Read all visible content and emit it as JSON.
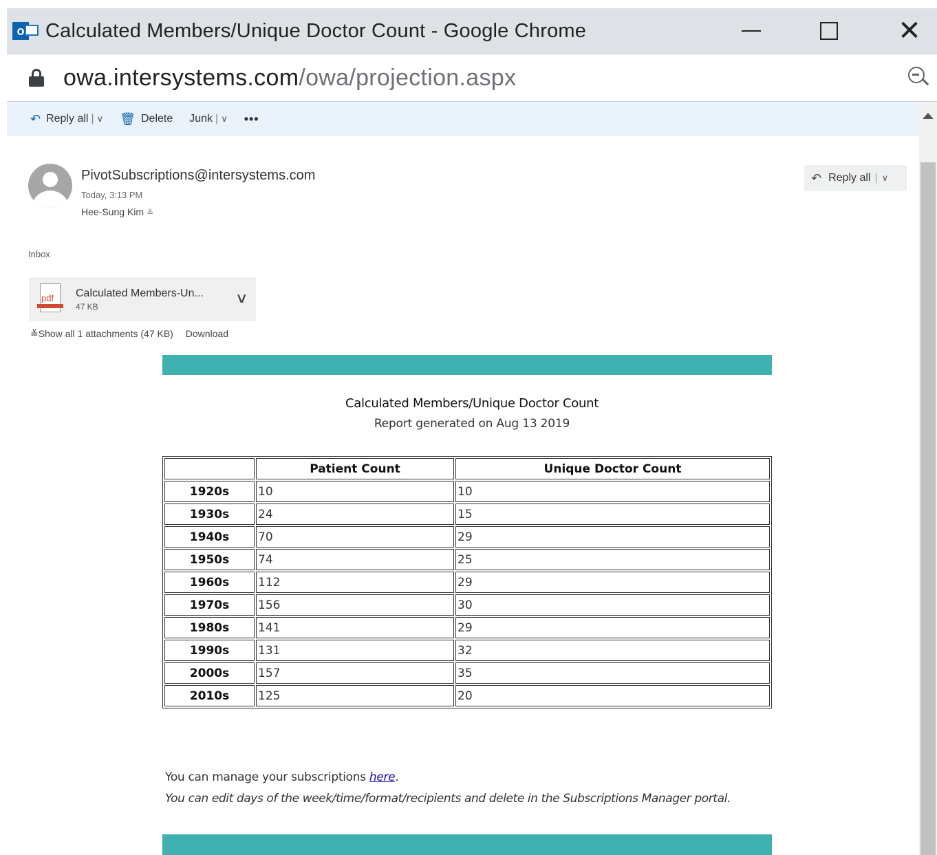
{
  "window": {
    "title": "Calculated Members/Unique Doctor Count - Google Chrome",
    "minimize_symbol": "",
    "maximize_symbol": "",
    "close_symbol": "✕"
  },
  "address": {
    "host": "owa.intersystems.com",
    "path": "/owa/projection.aspx"
  },
  "toolbar": {
    "reply_all": "Reply all",
    "delete": "Delete",
    "junk": "Junk",
    "more": "•••"
  },
  "email": {
    "sender": "PivotSubscriptions@intersystems.com",
    "time": "Today, 3:13 PM",
    "recipient": "Hee-Sung Kim",
    "folder": "Inbox",
    "reply_all": "Reply all",
    "attachment": {
      "name": "Calculated Members-Un...",
      "size": "47 KB",
      "icon_label": "pdf"
    },
    "show_all": "Show all 1 attachments (47 KB)",
    "download": "Download"
  },
  "report": {
    "title": "Calculated Members/Unique Doctor Count",
    "subtitle": "Report generated on Aug 13 2019",
    "columns": [
      "",
      "Patient Count",
      "Unique Doctor Count"
    ],
    "rows": [
      {
        "label": "1920s",
        "patient": "10",
        "doctor": "10"
      },
      {
        "label": "1930s",
        "patient": "24",
        "doctor": "15"
      },
      {
        "label": "1940s",
        "patient": "70",
        "doctor": "29"
      },
      {
        "label": "1950s",
        "patient": "74",
        "doctor": "25"
      },
      {
        "label": "1960s",
        "patient": "112",
        "doctor": "29"
      },
      {
        "label": "1970s",
        "patient": "156",
        "doctor": "30"
      },
      {
        "label": "1980s",
        "patient": "141",
        "doctor": "29"
      },
      {
        "label": "1990s",
        "patient": "131",
        "doctor": "32"
      },
      {
        "label": "2000s",
        "patient": "157",
        "doctor": "35"
      },
      {
        "label": "2010s",
        "patient": "125",
        "doctor": "20"
      }
    ],
    "footer_manage": "You can manage your subscriptions ",
    "footer_link": "here",
    "footer_period": ".",
    "footer_edit": "You can edit days of the week/time/format/recipients and delete in the Subscriptions Manager portal.",
    "accent_color": "#3fb1b1"
  }
}
